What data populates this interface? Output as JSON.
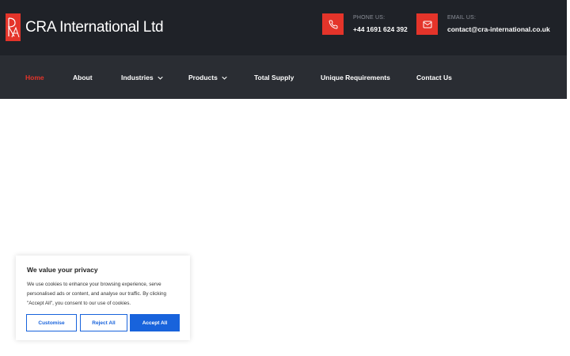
{
  "header": {
    "logo_text": "CRA International Ltd",
    "phone": {
      "label": "PHONE US:",
      "value": "+44 1691 624 392"
    },
    "email": {
      "label": "EMAIL US:",
      "value": "contact@cra-international.co.uk"
    }
  },
  "nav": {
    "items": [
      {
        "label": "Home",
        "active": true,
        "has_dropdown": false
      },
      {
        "label": "About",
        "active": false,
        "has_dropdown": false
      },
      {
        "label": "Industries",
        "active": false,
        "has_dropdown": true
      },
      {
        "label": "Products",
        "active": false,
        "has_dropdown": true
      },
      {
        "label": "Total Supply",
        "active": false,
        "has_dropdown": false
      },
      {
        "label": "Unique Requirements",
        "active": false,
        "has_dropdown": false
      },
      {
        "label": "Contact Us",
        "active": false,
        "has_dropdown": false
      }
    ]
  },
  "cookie_banner": {
    "title": "We value your privacy",
    "body": "We use cookies to enhance your browsing experience, serve personalised ads or content, and analyse our traffic. By clicking \"Accept All\", you consent to our use of cookies.",
    "customise_label": "Customise",
    "reject_label": "Reject All",
    "accept_label": "Accept All"
  },
  "colors": {
    "accent": "#e4342a",
    "topbar": "#1f2228",
    "navbar": "#2a2d33",
    "button_blue": "#1863dc"
  },
  "icons": {
    "phone": "phone-icon",
    "email": "envelope-icon",
    "dropdown": "chevron-down-icon"
  }
}
